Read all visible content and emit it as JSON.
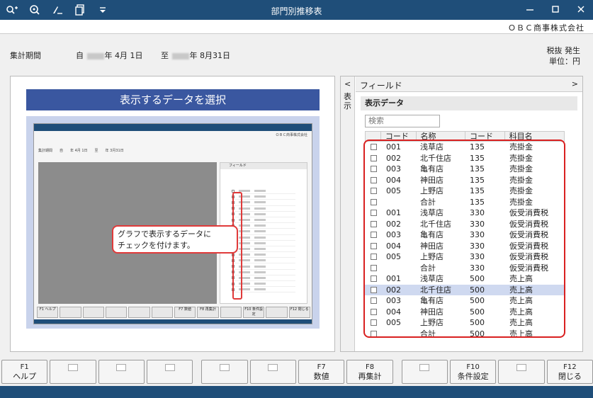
{
  "window": {
    "title": "部門別推移表"
  },
  "company": "ＯＢＣ商事株式会社",
  "header": {
    "period_label": "集計期間",
    "from_prefix": "自",
    "from_suffix": "年  4月 1日",
    "to_prefix": "至",
    "to_suffix": "年  8月31日",
    "tax": "税抜     発生",
    "unit": "単位：円"
  },
  "left": {
    "banner": "表示するデータを選択",
    "callout_line1": "グラフで表示するデータに",
    "callout_line2": "チェックを付けます。",
    "mini_company": "ＯＢＣ商事株式会社",
    "mini_period": "集計期間　　自　　年 4月 1日　　至　　年 3月31日",
    "mini_field": "フィールド",
    "mini_keys": [
      "F1 ヘルプ",
      "",
      "",
      "",
      "",
      "",
      "F7 数値",
      "F8 再集計",
      "",
      "F10 条件設定",
      "",
      "F12 閉じる"
    ]
  },
  "right": {
    "tab_arrow": "<",
    "tab_label": "表示",
    "field_title": "フィールド",
    "field_arrow": ">",
    "section": "表示データ",
    "search_placeholder": "検索",
    "columns": [
      "",
      "コード",
      "名称",
      "コード",
      "科目名"
    ],
    "rows": [
      [
        "001",
        "浅草店",
        "135",
        "売掛金"
      ],
      [
        "002",
        "北千住店",
        "135",
        "売掛金"
      ],
      [
        "003",
        "亀有店",
        "135",
        "売掛金"
      ],
      [
        "004",
        "神田店",
        "135",
        "売掛金"
      ],
      [
        "005",
        "上野店",
        "135",
        "売掛金"
      ],
      [
        "",
        "合計",
        "135",
        "売掛金"
      ],
      [
        "001",
        "浅草店",
        "330",
        "仮受消費税"
      ],
      [
        "002",
        "北千住店",
        "330",
        "仮受消費税"
      ],
      [
        "003",
        "亀有店",
        "330",
        "仮受消費税"
      ],
      [
        "004",
        "神田店",
        "330",
        "仮受消費税"
      ],
      [
        "005",
        "上野店",
        "330",
        "仮受消費税"
      ],
      [
        "",
        "合計",
        "330",
        "仮受消費税"
      ],
      [
        "001",
        "浅草店",
        "500",
        "売上高"
      ],
      [
        "002",
        "北千住店",
        "500",
        "売上高"
      ],
      [
        "003",
        "亀有店",
        "500",
        "売上高"
      ],
      [
        "004",
        "神田店",
        "500",
        "売上高"
      ],
      [
        "005",
        "上野店",
        "500",
        "売上高"
      ],
      [
        "",
        "合計",
        "500",
        "売上高"
      ]
    ],
    "selected_row": 13
  },
  "fkeys": [
    {
      "num": "F1",
      "label": "ヘルプ"
    },
    {
      "num": "",
      "label": ""
    },
    {
      "num": "",
      "label": ""
    },
    {
      "num": "",
      "label": ""
    },
    {
      "num": "",
      "label": ""
    },
    {
      "num": "",
      "label": ""
    },
    {
      "num": "F7",
      "label": "数値"
    },
    {
      "num": "F8",
      "label": "再集計"
    },
    {
      "num": "",
      "label": ""
    },
    {
      "num": "F10",
      "label": "条件設定"
    },
    {
      "num": "",
      "label": ""
    },
    {
      "num": "F12",
      "label": "閉じる"
    }
  ],
  "icons": [
    "search-add-icon",
    "zoom-icon",
    "edit-sign-icon",
    "copy-icon",
    "dropdown-icon"
  ],
  "colors": {
    "titlebar": "#1f4e79",
    "banner": "#3a57a0",
    "highlight": "#d92020",
    "selected_row": "#cfd9f0"
  }
}
